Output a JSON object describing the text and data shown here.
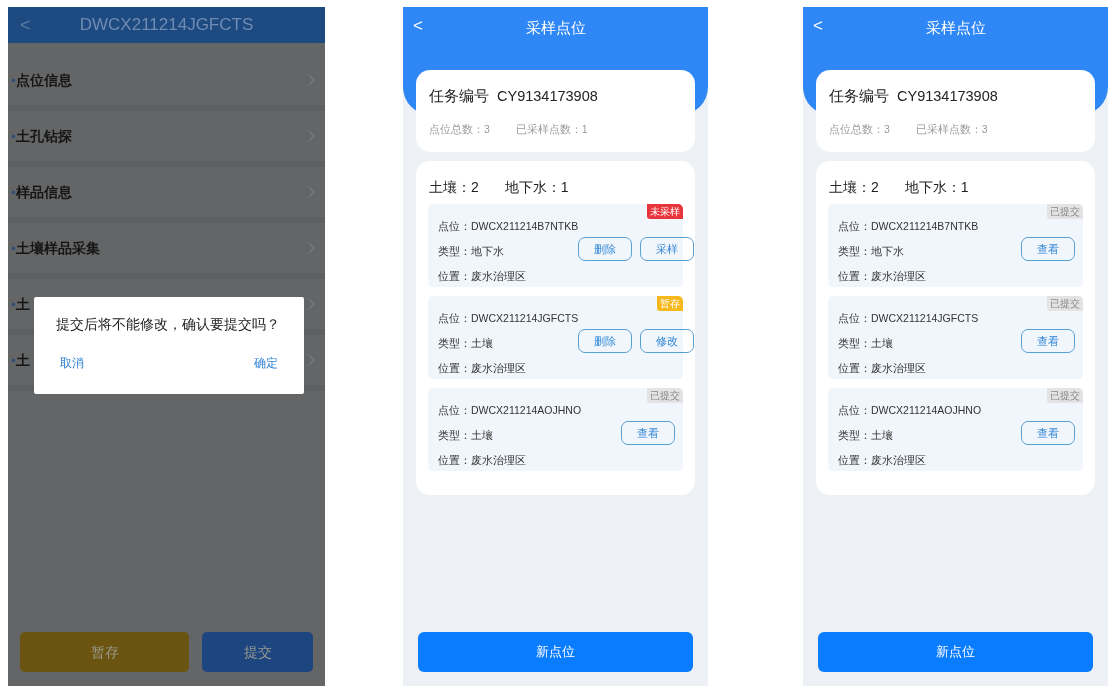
{
  "screens": [
    {
      "kind": "detail",
      "header": {
        "back": "<",
        "title": "DWCX211214JGFCTS"
      },
      "items": [
        {
          "label": "点位信息"
        },
        {
          "label": "土孔钻探"
        },
        {
          "label": "样品信息"
        },
        {
          "label": "土壤样品采集"
        },
        {
          "label": "土"
        },
        {
          "label": "土"
        }
      ],
      "dialog": {
        "message": "提交后将不能修改，确认要提交吗？",
        "cancel": "取消",
        "confirm": "确定"
      },
      "buttons": [
        {
          "label": "暂存",
          "color": "#6b5310"
        },
        {
          "label": "提交",
          "color": "#1d4680"
        }
      ]
    },
    {
      "kind": "sampling",
      "header": {
        "back": "<",
        "title": "采样点位"
      },
      "task": {
        "label": "任务编号",
        "number": "CY9134173908",
        "total": "点位总数：3",
        "sampled": "已采样点数：1"
      },
      "counts": [
        "土壤：2",
        "地下水：1"
      ],
      "points": [
        {
          "point": "点位：DWCX211214B7NTKB",
          "type": "类型：地下水",
          "location": "位置：废水治理区",
          "status": {
            "label": "未采样",
            "color": "#e8343b"
          },
          "actions": [
            "删除",
            "采样"
          ]
        },
        {
          "point": "点位：DWCX211214JGFCTS",
          "type": "类型：土壤",
          "location": "位置：废水治理区",
          "status": {
            "label": "暂存",
            "color": "#f6b81b"
          },
          "actions": [
            "删除",
            "修改"
          ]
        },
        {
          "point": "点位：DWCX211214AOJHNO",
          "type": "类型：土壤",
          "location": "位置：废水治理区",
          "status": {
            "label": "已提交",
            "color": "#e3e3e3"
          },
          "actions": [
            "查看"
          ]
        }
      ],
      "new_button": "新点位"
    },
    {
      "kind": "sampling",
      "header": {
        "back": "<",
        "title": "采样点位"
      },
      "task": {
        "label": "任务编号",
        "number": "CY9134173908",
        "total": "点位总数：3",
        "sampled": "已采样点数：3"
      },
      "counts": [
        "土壤：2",
        "地下水：1"
      ],
      "points": [
        {
          "point": "点位：DWCX211214B7NTKB",
          "type": "类型：地下水",
          "location": "位置：废水治理区",
          "status": {
            "label": "已提交",
            "color": "#e3e3e3"
          },
          "actions": [
            "查看"
          ]
        },
        {
          "point": "点位：DWCX211214JGFCTS",
          "type": "类型：土壤",
          "location": "位置：废水治理区",
          "status": {
            "label": "已提交",
            "color": "#e3e3e3"
          },
          "actions": [
            "查看"
          ]
        },
        {
          "point": "点位：DWCX211214AOJHNO",
          "type": "类型：土壤",
          "location": "位置：废水治理区",
          "status": {
            "label": "已提交",
            "color": "#e3e3e3"
          },
          "actions": [
            "查看"
          ]
        }
      ],
      "new_button": "新点位"
    }
  ]
}
